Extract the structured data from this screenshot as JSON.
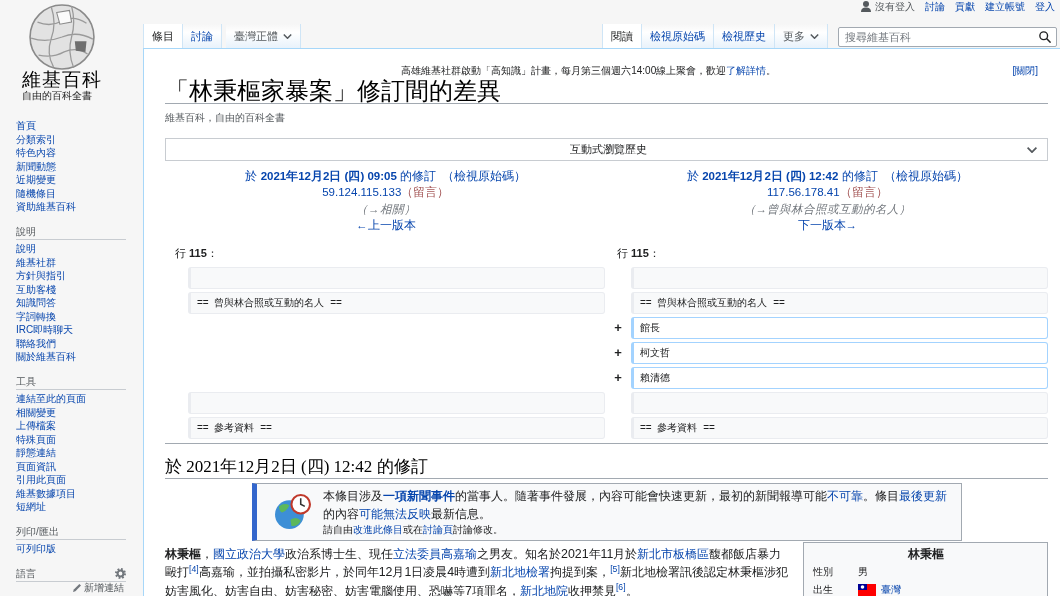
{
  "logo": {
    "wordmark": "維基百科",
    "tagline": "自由的百科全書"
  },
  "sidebar": {
    "main_links": [
      "首頁",
      "分類索引",
      "特色內容",
      "新聞動態",
      "近期變更",
      "隨機條目",
      "資助維基百科"
    ],
    "sections": [
      {
        "kind": "links",
        "heading": "說明",
        "items": [
          "說明",
          "維基社群",
          "方針與指引",
          "互助客棧",
          "知識問答",
          "字詞轉換",
          "IRC即時聊天",
          "聯絡我們",
          "關於維基百科"
        ]
      },
      {
        "kind": "links",
        "heading": "工具",
        "items": [
          "連結至此的頁面",
          "相關變更",
          "上傳檔案",
          "特殊頁面",
          "靜態連結",
          "頁面資訊",
          "引用此頁面",
          "維基數據項目",
          "短網址"
        ]
      },
      {
        "kind": "links",
        "heading": "列印/匯出",
        "items": [
          "可列印版"
        ]
      },
      {
        "kind": "languages",
        "heading": "語言",
        "add_link": "新增連結"
      }
    ]
  },
  "personal_bar": {
    "status": "沒有登入",
    "links": [
      "討論",
      "貢獻",
      "建立帳號",
      "登入"
    ]
  },
  "namespace_tabs": [
    {
      "label": "條目",
      "selected": true
    },
    {
      "label": "討論",
      "selected": false
    }
  ],
  "variant_menu": {
    "label": "臺灣正體"
  },
  "view_tabs": [
    {
      "label": "閱讀",
      "selected": true
    },
    {
      "label": "檢視原始碼",
      "selected": false
    },
    {
      "label": "檢視歷史",
      "selected": false
    }
  ],
  "more_menu": {
    "label": "更多"
  },
  "search": {
    "placeholder": "搜尋維基百科"
  },
  "site_notice": {
    "segments": [
      {
        "kind": "text",
        "text": "高雄維基社群啟動「高知識」計畫，每月第三個週六14:00線上聚會，歡迎"
      },
      {
        "kind": "link",
        "text": "了解詳情"
      },
      {
        "kind": "text",
        "text": "。"
      }
    ],
    "dismiss": "[關閉]"
  },
  "page_title": "「林秉樞家暴案」修訂間的差異",
  "tagline": "維基百科，自由的百科全書",
  "collapsible": {
    "label": "互動式瀏覽歷史",
    "expanded": false
  },
  "diff_header": [
    {
      "revision": "於 **2021年12月2日 (四) 09:05** 的修訂",
      "source": "（檢視原始碼）",
      "user": "59.124.115.133",
      "talk": "（留言）",
      "summary": "（→相關）",
      "nav": "←上一版本"
    },
    {
      "revision": "於 **2021年12月2日 (四) 12:42** 的修訂",
      "source": "（檢視原始碼）",
      "user": "117.56.178.41",
      "talk": "（留言）",
      "summary": "（→曾與林合照或互動的名人）",
      "nav": "下一版本→"
    }
  ],
  "diff": {
    "line_labels": [
      "行 **115**：",
      "行 **115**："
    ],
    "rows": [
      {
        "kind": "context"
      },
      {
        "kind": "context",
        "left": "== 曾與林合照或互動的名人 ==",
        "right": "== 曾與林合照或互動的名人 =="
      },
      {
        "kind": "added",
        "marker": "+",
        "right": "館長"
      },
      {
        "kind": "added",
        "marker": "+",
        "right": "柯文哲"
      },
      {
        "kind": "added",
        "marker": "+",
        "right": "賴清德"
      },
      {
        "kind": "context"
      },
      {
        "kind": "context",
        "left": "== 參考資料 ==",
        "right": "== 參考資料 =="
      }
    ]
  },
  "revision_heading": "於 2021年12月2日 (四) 12:42 的修訂",
  "notice": {
    "lines": [
      {
        "kind": "main",
        "segments": [
          {
            "kind": "text",
            "text": "本條目涉及"
          },
          {
            "kind": "bold_link",
            "text": "一項新聞事件"
          },
          {
            "kind": "text",
            "text": "的當事人。隨著事件發展，內容可能會快速更新，最初的新聞報導可能"
          },
          {
            "kind": "link",
            "text": "不可靠"
          },
          {
            "kind": "text",
            "text": "。條目"
          },
          {
            "kind": "link",
            "text": "最後更新"
          },
          {
            "kind": "text",
            "text": "的內容"
          },
          {
            "kind": "link",
            "text": "可能無法反映"
          },
          {
            "kind": "text",
            "text": "最新信息。"
          }
        ]
      },
      {
        "kind": "small",
        "segments": [
          {
            "kind": "text",
            "text": "請自由"
          },
          {
            "kind": "link",
            "text": "改進此條目"
          },
          {
            "kind": "text",
            "text": "或在"
          },
          {
            "kind": "link",
            "text": "討論頁"
          },
          {
            "kind": "text",
            "text": "討論修改。"
          }
        ]
      }
    ]
  },
  "article": {
    "segments": [
      {
        "kind": "bold",
        "text": "林秉樞"
      },
      {
        "kind": "text",
        "text": "，"
      },
      {
        "kind": "link",
        "text": "國立政治大學"
      },
      {
        "kind": "text",
        "text": "政治系博士生、現任"
      },
      {
        "kind": "link",
        "text": "立法委員"
      },
      {
        "kind": "link",
        "text": "高嘉瑜"
      },
      {
        "kind": "text",
        "text": "之男友。知名於2021年11月於"
      },
      {
        "kind": "link",
        "text": "新北市"
      },
      {
        "kind": "link",
        "text": "板橋區"
      },
      {
        "kind": "text",
        "text": "馥都飯店暴力毆打"
      },
      {
        "kind": "ref",
        "text": "[4]"
      },
      {
        "kind": "text",
        "text": "高嘉瑜，並拍攝私密影片，於同年12月1日凌晨4時遭到"
      },
      {
        "kind": "link",
        "text": "新北地檢署"
      },
      {
        "kind": "text",
        "text": "拘提到案，"
      },
      {
        "kind": "ref",
        "text": "[5]"
      },
      {
        "kind": "text",
        "text": "新北地檢署訊後認定林秉樞涉犯妨害風化、妨害自由、妨害秘密、妨害電腦使用、恐嚇等7項罪名，"
      },
      {
        "kind": "link",
        "text": "新北地院"
      },
      {
        "kind": "text",
        "text": "收押禁見"
      },
      {
        "kind": "ref",
        "text": "[6]"
      },
      {
        "kind": "text",
        "text": "。"
      }
    ]
  },
  "infobox": {
    "title": "林秉樞",
    "rows": [
      {
        "kind": "plain",
        "label": "性別",
        "value": "男"
      },
      {
        "kind": "flag_link",
        "label": "出生",
        "value": "臺灣"
      }
    ]
  }
}
